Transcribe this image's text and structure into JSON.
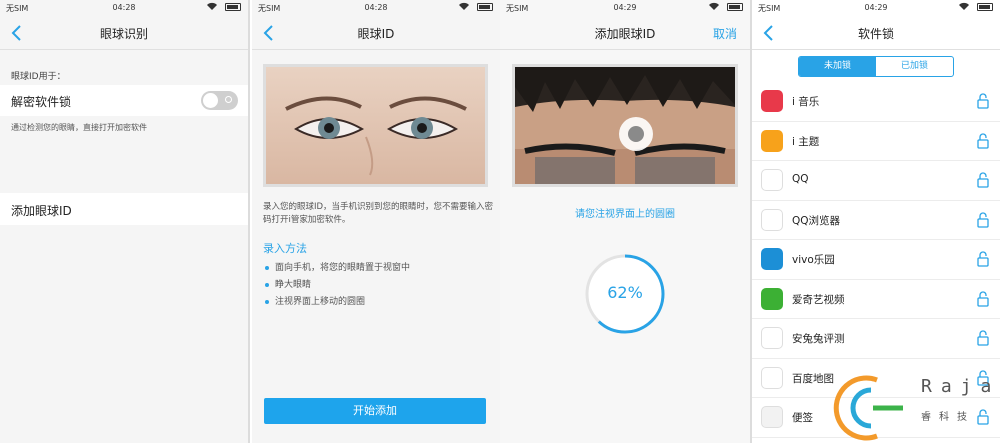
{
  "screen1": {
    "carrier": "无SIM",
    "time": "04:28",
    "title": "眼球识别",
    "section_label": "眼球ID用于：",
    "row_unlock_label": "解密软件锁",
    "description": "通过检测您的眼睛，直接打开加密软件",
    "row_add_label": "添加眼球ID"
  },
  "screen2": {
    "carrier": "无SIM",
    "time": "04:28",
    "title": "眼球ID",
    "description": "录入您的眼球ID，当手机识别到您的眼睛时，您不需要输入密码打开i管家加密软件。",
    "method_title": "录入方法",
    "steps": [
      "面向手机，将您的眼睛置于视窗中",
      "睁大眼睛",
      "注视界面上移动的圆圈"
    ],
    "start_button": "开始添加"
  },
  "screen3": {
    "carrier": "无SIM",
    "time": "04:29",
    "title": "添加眼球ID",
    "cancel": "取消",
    "hint": "请您注视界面上的圆圈",
    "progress_label": "62%",
    "progress_value": 0.62,
    "accent": "#29a3e6"
  },
  "screen4": {
    "carrier": "无SIM",
    "time": "04:29",
    "title": "软件锁",
    "tabs": [
      "未加锁",
      "已加锁"
    ],
    "apps": [
      {
        "name": "i 音乐",
        "icon": "music-icon",
        "color": "#e8394a"
      },
      {
        "name": "i 主题",
        "icon": "theme-icon",
        "color": "#f7a21b"
      },
      {
        "name": "QQ",
        "icon": "qq-icon",
        "color": "#ffffff"
      },
      {
        "name": "QQ浏览器",
        "icon": "qq-browser-icon",
        "color": "#ffffff"
      },
      {
        "name": "vivo乐园",
        "icon": "vivo-park-icon",
        "color": "#1c8fd6"
      },
      {
        "name": "爱奇艺视频",
        "icon": "iqiyi-icon",
        "color": "#3cb034"
      },
      {
        "name": "安兔兔评测",
        "icon": "antutu-icon",
        "color": "#ffffff"
      },
      {
        "name": "百度地图",
        "icon": "baidu-map-icon",
        "color": "#ffffff"
      },
      {
        "name": "便签",
        "icon": "notes-icon",
        "color": "#f2f2f2"
      }
    ]
  },
  "watermark": {
    "text": "Raja",
    "sub": "睿科技"
  }
}
